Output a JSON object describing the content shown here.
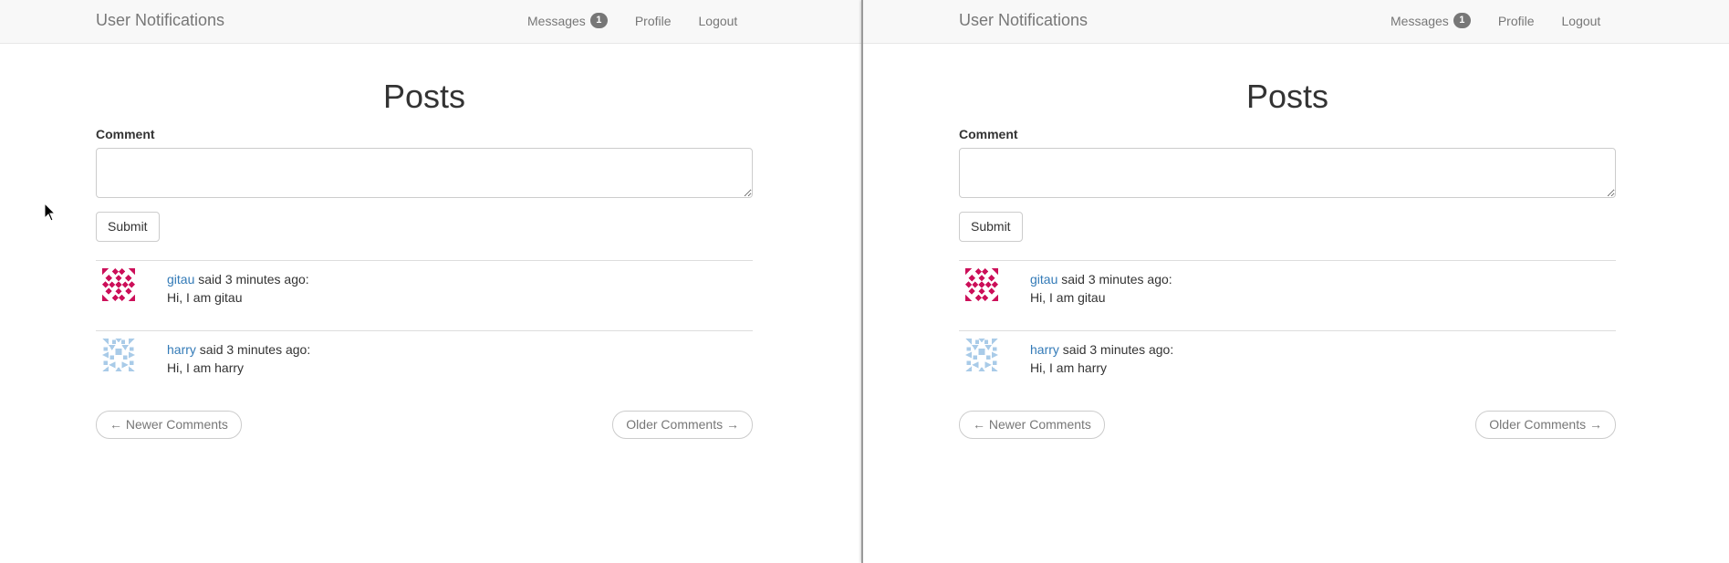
{
  "windows": [
    {
      "navbar": {
        "brand": "User Notifications",
        "messages_label": "Messages",
        "messages_count": "1",
        "profile_label": "Profile",
        "logout_label": "Logout"
      },
      "page_title": "Posts",
      "form": {
        "comment_label": "Comment",
        "comment_value": "",
        "submit_label": "Submit"
      },
      "posts": [
        {
          "author": "gitau",
          "meta": " said 3 minutes ago:",
          "body": "Hi, I am gitau",
          "avatar": "identicon-gitau"
        },
        {
          "author": "harry",
          "meta": " said 3 minutes ago:",
          "body": "Hi, I am harry",
          "avatar": "identicon-harry"
        }
      ],
      "pager": {
        "newer_label": "← Newer Comments",
        "older_label": "Older Comments →"
      }
    },
    {
      "navbar": {
        "brand": "User Notifications",
        "messages_label": "Messages",
        "messages_count": "1",
        "profile_label": "Profile",
        "logout_label": "Logout"
      },
      "page_title": "Posts",
      "form": {
        "comment_label": "Comment",
        "comment_value": "",
        "submit_label": "Submit"
      },
      "posts": [
        {
          "author": "gitau",
          "meta": " said 3 minutes ago:",
          "body": "Hi, I am gitau",
          "avatar": "identicon-gitau"
        },
        {
          "author": "harry",
          "meta": " said 3 minutes ago:",
          "body": "Hi, I am harry",
          "avatar": "identicon-harry"
        }
      ],
      "pager": {
        "newer_label": "← Newer Comments",
        "older_label": "Older Comments →"
      }
    }
  ],
  "colors": {
    "link": "#337ab7",
    "badge": "#777777",
    "gitau_identicon": "#cc0f59",
    "harry_identicon": "#a9cbe8"
  }
}
